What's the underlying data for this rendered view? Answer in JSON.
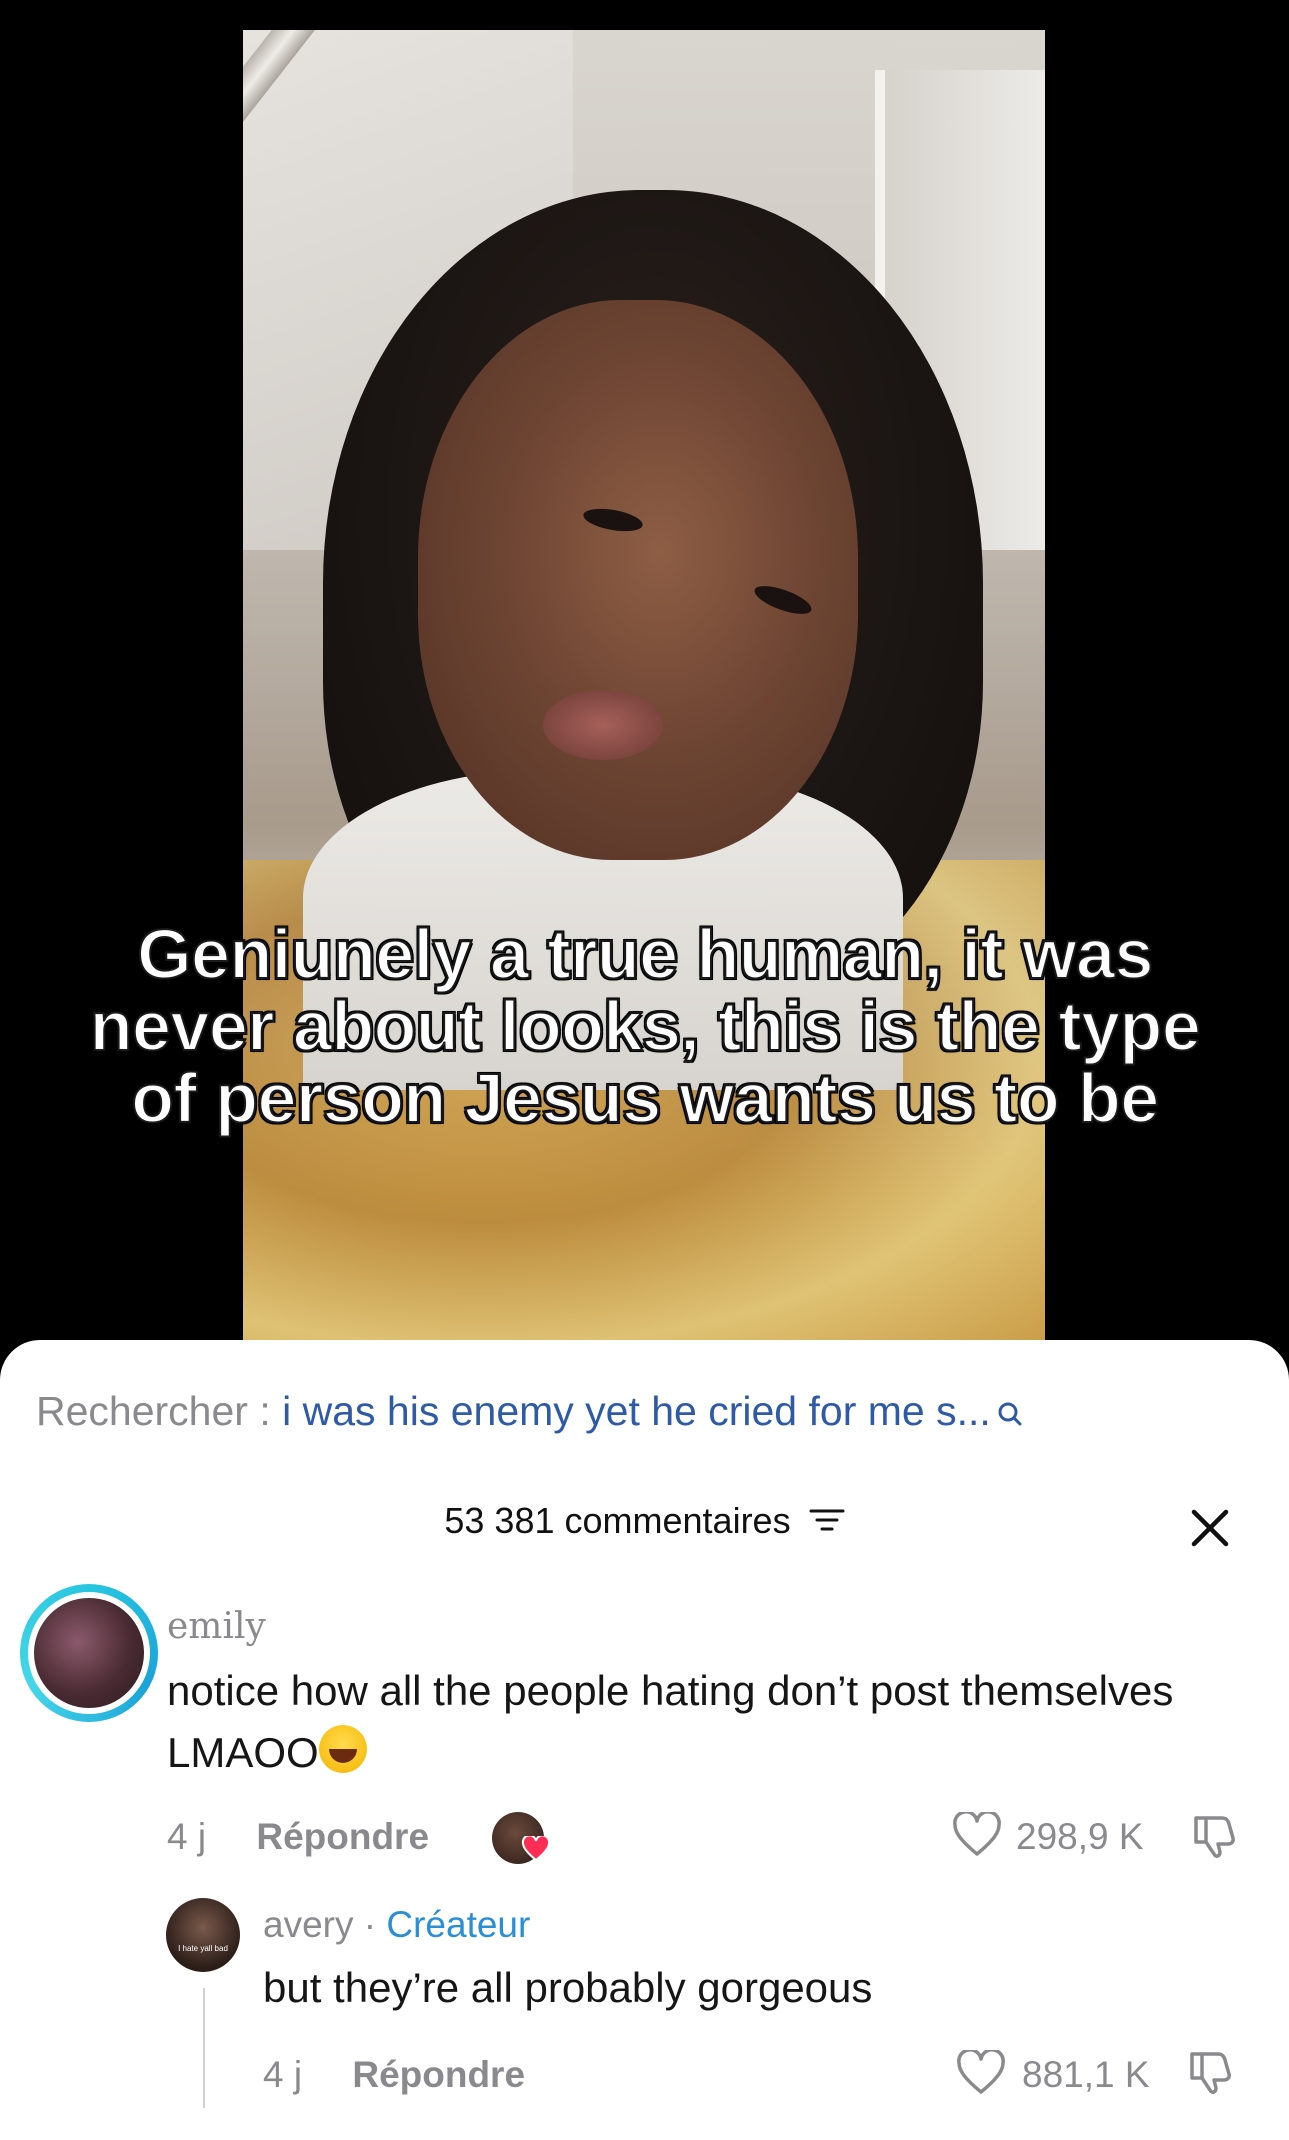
{
  "video": {
    "caption": "Geniunely a true human, it was never about looks, this is the type of person Jesus wants us to be"
  },
  "search": {
    "label": "Rechercher : ",
    "query": "i was his enemy yet he cried for me s..."
  },
  "comments_header": {
    "count": "53 381 commentaires"
  },
  "comment": {
    "username": "emily",
    "text": "notice how all the people hating don’t post themselves LMAOO",
    "time": "4 j",
    "reply_label": "Répondre",
    "likes": "298,9 K"
  },
  "reply": {
    "username": "avery",
    "separator": " · ",
    "creator_label": "Créateur",
    "avatar_text": "I hate yall bad",
    "text": "but they’re all probably gorgeous",
    "time": "4 j",
    "reply_label": "Répondre",
    "likes": "881,1 K"
  },
  "colors": {
    "accent_blue": "#2b8fd6",
    "search_query_blue": "#2e5aa8",
    "muted_gray": "#8a8a8e",
    "story_ring": "#27c6e0",
    "heart_badge": "#ff2d55"
  },
  "icons": [
    "search-icon",
    "filter-icon",
    "close-icon",
    "heart-icon",
    "dislike-icon",
    "laughing-emoji-icon"
  ]
}
